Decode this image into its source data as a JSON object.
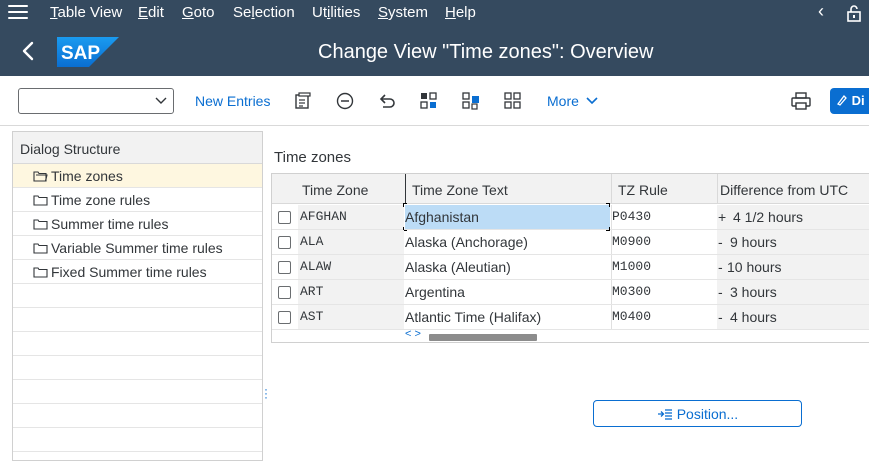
{
  "menubar": {
    "items": [
      "Table View",
      "Edit",
      "Goto",
      "Selection",
      "Utilities",
      "System",
      "Help"
    ],
    "underline_letters": [
      "T",
      "E",
      "G",
      "l",
      "i",
      "S",
      "H"
    ]
  },
  "header": {
    "title": "Change View \"Time zones\": Overview",
    "logo_text": "SAP"
  },
  "toolbar": {
    "combo_value": "",
    "new_entries_label": "New Entries",
    "more_label": "More",
    "di_button_label": "Di",
    "icons": [
      "copy-as-icon",
      "delete-icon",
      "undo-icon",
      "select-all-icon",
      "select-block-icon",
      "deselect-all-icon",
      "print-icon",
      "display-icon"
    ]
  },
  "dialog_structure": {
    "header": "Dialog Structure",
    "items": [
      {
        "label": "Time zones",
        "selected": true
      },
      {
        "label": "Time zone rules",
        "selected": false
      },
      {
        "label": "Summer time rules",
        "selected": false
      },
      {
        "label": "Variable Summer time rules",
        "selected": false
      },
      {
        "label": "Fixed Summer time rules",
        "selected": false
      }
    ]
  },
  "main": {
    "section_title": "Time zones",
    "columns": [
      "Time Zone",
      "Time Zone Text",
      "TZ Rule",
      "Difference from UTC"
    ],
    "rows": [
      {
        "tz": "AFGHAN",
        "text": "Afghanistan",
        "rule": "P0430",
        "sign": "+",
        "diff": "4 1/2 hours"
      },
      {
        "tz": "ALA",
        "text": "Alaska (Anchorage)",
        "rule": "M0900",
        "sign": "-",
        "diff": "9 hours"
      },
      {
        "tz": "ALAW",
        "text": "Alaska (Aleutian)",
        "rule": "M1000",
        "sign": "-",
        "diff": "10 hours"
      },
      {
        "tz": "ART",
        "text": "Argentina",
        "rule": "M0300",
        "sign": "-",
        "diff": "3 hours"
      },
      {
        "tz": "AST",
        "text": "Atlantic Time (Halifax)",
        "rule": "M0400",
        "sign": "-",
        "diff": "4 hours"
      }
    ],
    "scroll_arrows": "< >",
    "position_button": "Position..."
  },
  "colors": {
    "shell": "#354a5f",
    "accent": "#0a6ed1",
    "selected_row": "#fef7e0",
    "focus_cell": "#bcdcf6"
  }
}
